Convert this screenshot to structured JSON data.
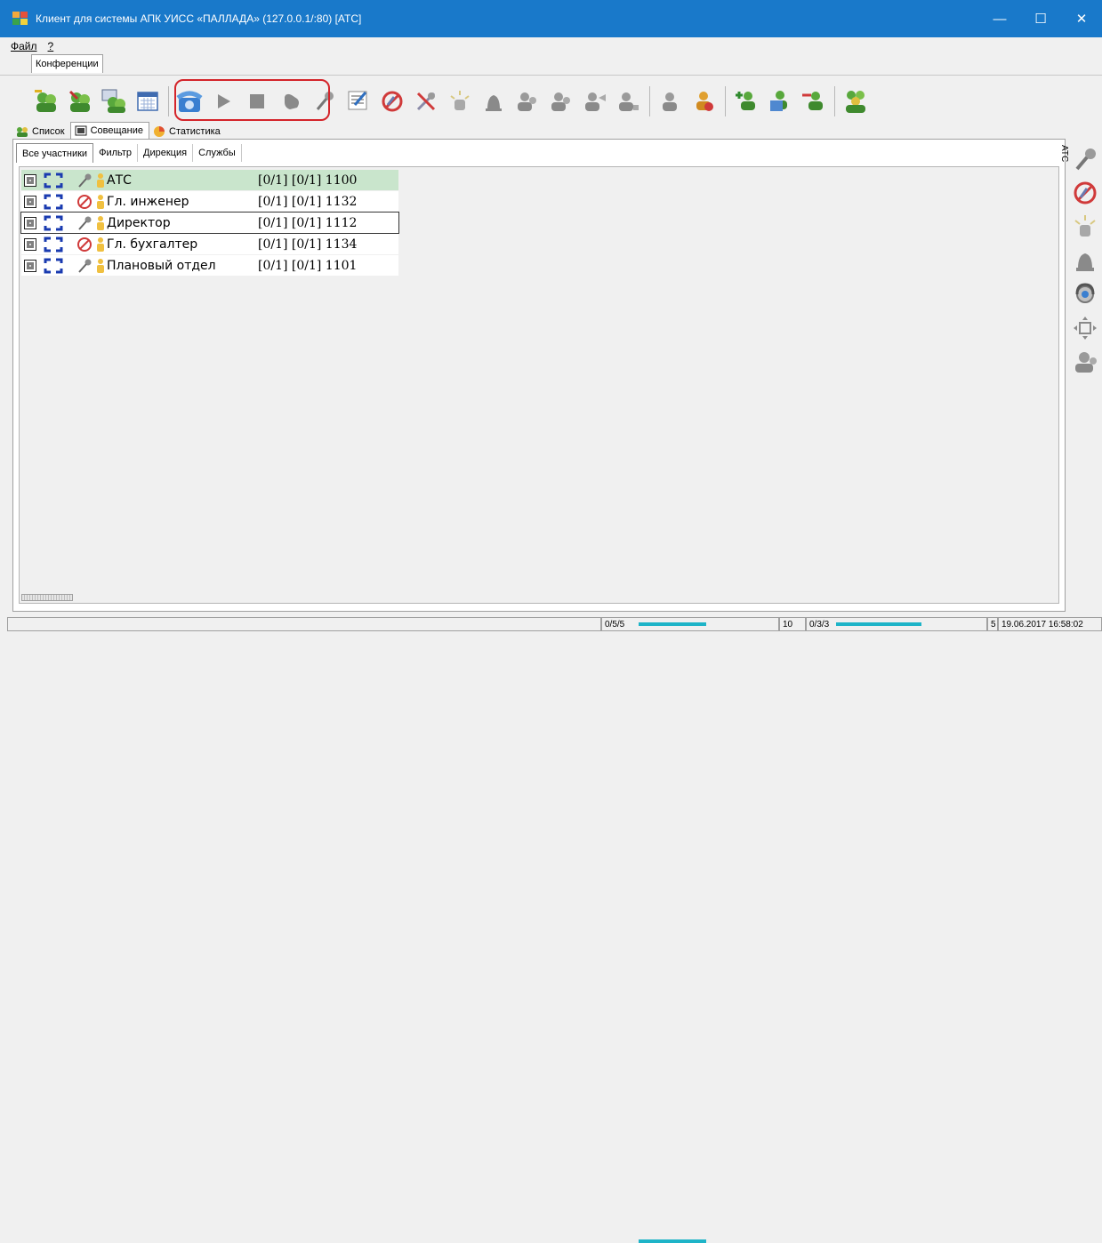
{
  "window": {
    "title": "Клиент для системы АПК УИСС «ПАЛЛАДА» (127.0.0.1/:80) [АТС]"
  },
  "window_controls": {
    "minimize": "—",
    "maximize": "☐",
    "close": "✕"
  },
  "menu": {
    "file": "Файл",
    "help": "?"
  },
  "conference_tab": "Конференции",
  "toolbar_icons": [
    "add-conference-icon",
    "edit-conference-icon",
    "conference-settings-icon",
    "calendar-icon",
    "phone-dial-icon",
    "play-icon",
    "stop-icon",
    "hand-icon",
    "mic-on-icon",
    "list-import-icon",
    "mic-off-icon",
    "mute-all-icon",
    "alarm-icon",
    "bell-icon",
    "user-group-1-icon",
    "user-group-2-icon",
    "user-group-3-icon",
    "user-group-4-icon",
    "user-call-icon",
    "user-alert-icon",
    "add-participant-icon",
    "participant-list-icon",
    "remove-participant-icon",
    "group-participants-icon"
  ],
  "view_tabs": [
    {
      "label": "Список",
      "icon": "group-icon"
    },
    {
      "label": "Совещание",
      "icon": "meeting-icon"
    },
    {
      "label": "Статистика",
      "icon": "statistics-icon"
    }
  ],
  "sub_tabs": [
    "Все участники",
    "Фильтр",
    "Дирекция",
    "Службы"
  ],
  "participants": [
    {
      "name": "АТС",
      "info": "[0/1] [0/1] 1100",
      "mic": "mic-on-icon",
      "selected": true,
      "boxed": false
    },
    {
      "name": "Гл. инженер",
      "info": "[0/1] [0/1] 1132",
      "mic": "mic-off-icon",
      "selected": false,
      "boxed": false
    },
    {
      "name": "Директор",
      "info": "[0/1] [0/1] 1112",
      "mic": "mic-on-icon",
      "selected": false,
      "boxed": true
    },
    {
      "name": "Гл. бухгалтер",
      "info": "[0/1] [0/1] 1134",
      "mic": "mic-off-icon",
      "selected": false,
      "boxed": false
    },
    {
      "name": "Плановый отдел",
      "info": "[0/1] [0/1] 1101",
      "mic": "mic-on-icon",
      "selected": false,
      "boxed": false
    }
  ],
  "side_label": "АТС",
  "side_icons": [
    "mic-on-icon",
    "mic-off-icon",
    "alarm-icon",
    "bell-icon",
    "headset-icon",
    "move-icon",
    "user-icon"
  ],
  "status": {
    "cell1": "0/5/5",
    "cell2": "10",
    "cell3": "0/3/3",
    "cell4": "5",
    "datetime": "19.06.2017 16:58:02"
  },
  "colors": {
    "titlebar": "#1979ca",
    "highlight": "#d4242a",
    "selected_row": "#c9e5cc",
    "meter": "#1eb4c8"
  }
}
